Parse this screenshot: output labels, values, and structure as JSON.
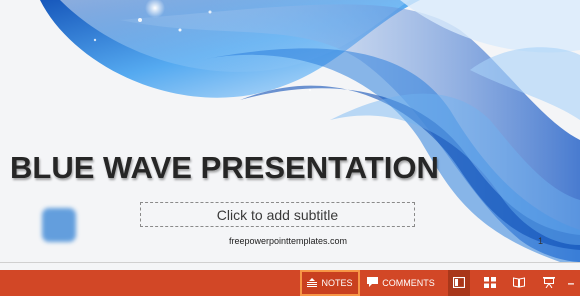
{
  "slide": {
    "title": "BLUE WAVE PRESENTATION",
    "subtitle_placeholder": "Click to add subtitle",
    "footer": "freepowerpointtemplates.com",
    "slide_number": "1"
  },
  "statusbar": {
    "notes_label": "NOTES",
    "comments_label": "COMMENTS",
    "zoom_out_label": "–",
    "notes_icon": "notes-icon",
    "comments_icon": "comment-icon",
    "normal_view_icon": "normal-view-icon",
    "sorter_view_icon": "slide-sorter-icon",
    "reading_view_icon": "reading-view-icon",
    "slideshow_icon": "slideshow-icon",
    "accent_color": "#d24726",
    "highlight_color": "#f79646"
  },
  "theme": {
    "wave_color": "#1f6fd1",
    "title_color": "#262626"
  }
}
